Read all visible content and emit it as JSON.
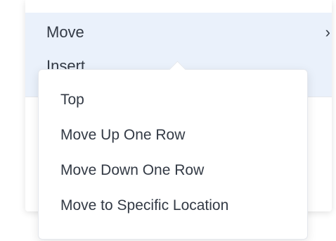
{
  "parent_menu": {
    "move_label": "Move",
    "move_arrow": "›",
    "insert_label": "Insert"
  },
  "submenu": {
    "items": [
      {
        "label": "Top"
      },
      {
        "label": "Move Up One Row"
      },
      {
        "label": "Move Down One Row"
      },
      {
        "label": "Move to Specific Location"
      }
    ]
  }
}
